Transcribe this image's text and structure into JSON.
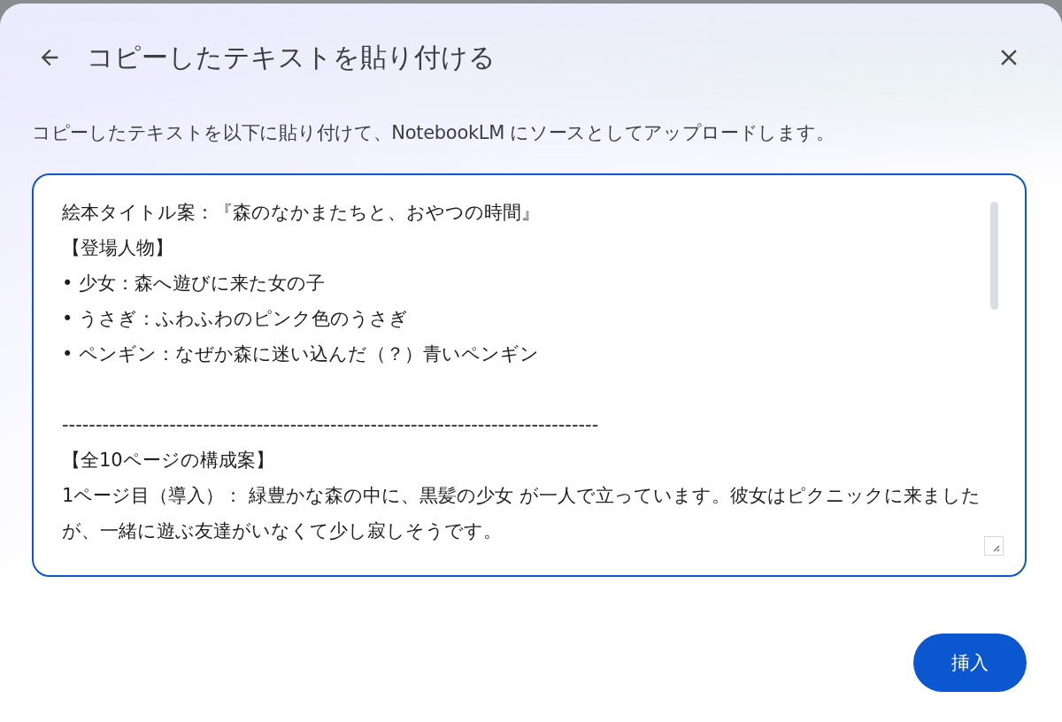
{
  "dialog": {
    "title": "コピーしたテキストを貼り付ける",
    "description": "コピーしたテキストを以下に貼り付けて、NotebookLM にソースとしてアップロードします。",
    "text_field": {
      "lines": [
        {
          "kind": "text",
          "text": "絵本タイトル案：『森のなかまたちと、おやつの時間』"
        },
        {
          "kind": "text",
          "text": "【登場人物】"
        },
        {
          "kind": "text",
          "text": "• 少女：森へ遊びに来た女の子"
        },
        {
          "kind": "text",
          "text": "• うさぎ：ふわふわのピンク色のうさぎ"
        },
        {
          "kind": "text",
          "text": "• ペンギン：なぜか森に迷い込んだ（？）青いペンギン"
        },
        {
          "kind": "rule",
          "text": "--------------------------------------------------------------------------------"
        },
        {
          "kind": "text",
          "text": "【全10ページの構成案】"
        },
        {
          "kind": "text",
          "text": "1ページ目（導入）： 緑豊かな森の中に、黒髪の少女 が一人で立っています。彼女はピクニックに来ましたが、一緒に遊ぶ友達がいなくて少し寂しそうです。"
        }
      ],
      "focused": true
    },
    "insert_button": "挿入"
  }
}
